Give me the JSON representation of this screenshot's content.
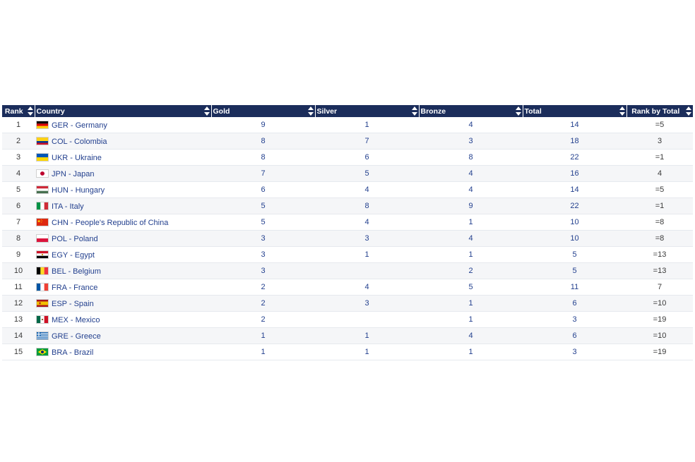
{
  "headers": {
    "rank": "Rank",
    "country": "Country",
    "gold": "Gold",
    "silver": "Silver",
    "bronze": "Bronze",
    "total": "Total",
    "rank_by_total": "Rank by Total"
  },
  "colors": {
    "header_bg": "#1b2d5b",
    "link_text": "#23408e"
  },
  "rows": [
    {
      "rank": "1",
      "code": "GER",
      "country": "GER - Germany",
      "gold": "9",
      "silver": "1",
      "bronze": "4",
      "total": "14",
      "rank_by_total": "=5"
    },
    {
      "rank": "2",
      "code": "COL",
      "country": "COL - Colombia",
      "gold": "8",
      "silver": "7",
      "bronze": "3",
      "total": "18",
      "rank_by_total": "3"
    },
    {
      "rank": "3",
      "code": "UKR",
      "country": "UKR - Ukraine",
      "gold": "8",
      "silver": "6",
      "bronze": "8",
      "total": "22",
      "rank_by_total": "=1"
    },
    {
      "rank": "4",
      "code": "JPN",
      "country": "JPN - Japan",
      "gold": "7",
      "silver": "5",
      "bronze": "4",
      "total": "16",
      "rank_by_total": "4"
    },
    {
      "rank": "5",
      "code": "HUN",
      "country": "HUN - Hungary",
      "gold": "6",
      "silver": "4",
      "bronze": "4",
      "total": "14",
      "rank_by_total": "=5"
    },
    {
      "rank": "6",
      "code": "ITA",
      "country": "ITA - Italy",
      "gold": "5",
      "silver": "8",
      "bronze": "9",
      "total": "22",
      "rank_by_total": "=1"
    },
    {
      "rank": "7",
      "code": "CHN",
      "country": "CHN - People's Republic of China",
      "gold": "5",
      "silver": "4",
      "bronze": "1",
      "total": "10",
      "rank_by_total": "=8"
    },
    {
      "rank": "8",
      "code": "POL",
      "country": "POL - Poland",
      "gold": "3",
      "silver": "3",
      "bronze": "4",
      "total": "10",
      "rank_by_total": "=8"
    },
    {
      "rank": "9",
      "code": "EGY",
      "country": "EGY - Egypt",
      "gold": "3",
      "silver": "1",
      "bronze": "1",
      "total": "5",
      "rank_by_total": "=13"
    },
    {
      "rank": "10",
      "code": "BEL",
      "country": "BEL - Belgium",
      "gold": "3",
      "silver": "",
      "bronze": "2",
      "total": "5",
      "rank_by_total": "=13"
    },
    {
      "rank": "11",
      "code": "FRA",
      "country": "FRA - France",
      "gold": "2",
      "silver": "4",
      "bronze": "5",
      "total": "11",
      "rank_by_total": "7"
    },
    {
      "rank": "12",
      "code": "ESP",
      "country": "ESP - Spain",
      "gold": "2",
      "silver": "3",
      "bronze": "1",
      "total": "6",
      "rank_by_total": "=10"
    },
    {
      "rank": "13",
      "code": "MEX",
      "country": "MEX - Mexico",
      "gold": "2",
      "silver": "",
      "bronze": "1",
      "total": "3",
      "rank_by_total": "=19"
    },
    {
      "rank": "14",
      "code": "GRE",
      "country": "GRE - Greece",
      "gold": "1",
      "silver": "1",
      "bronze": "4",
      "total": "6",
      "rank_by_total": "=10"
    },
    {
      "rank": "15",
      "code": "BRA",
      "country": "BRA - Brazil",
      "gold": "1",
      "silver": "1",
      "bronze": "1",
      "total": "3",
      "rank_by_total": "=19"
    }
  ]
}
